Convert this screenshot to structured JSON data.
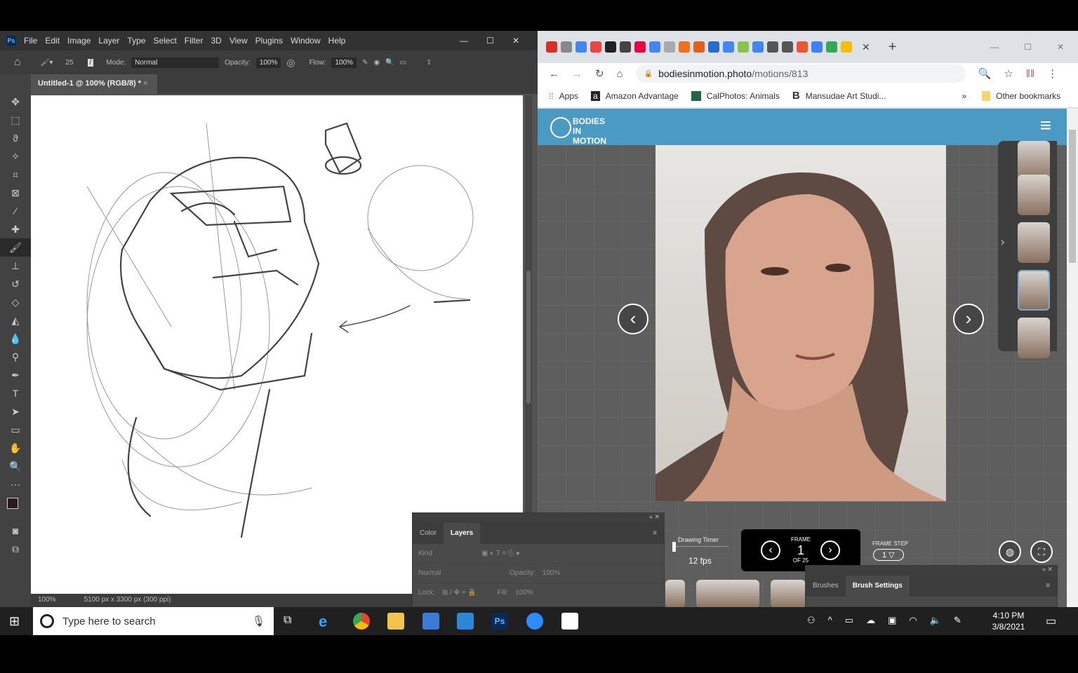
{
  "photoshop": {
    "menu": [
      "File",
      "Edit",
      "Image",
      "Layer",
      "Type",
      "Select",
      "Filter",
      "3D",
      "View",
      "Plugins",
      "Window",
      "Help"
    ],
    "options": {
      "brush_size": "25",
      "mode_label": "Mode:",
      "mode_value": "Normal",
      "opacity_label": "Opacity:",
      "opacity_value": "100%",
      "flow_label": "Flow:",
      "flow_value": "100%"
    },
    "doc_tab": "Untitled-1 @ 100% (RGB/8) *",
    "status": {
      "zoom": "100%",
      "doc_size": "5100 px x 3300 px (300 ppi)"
    },
    "layers_panel": {
      "tabs": [
        "Color",
        "Layers"
      ],
      "kind": "Kind",
      "blend": "Normal",
      "opacity_label": "Opacity:",
      "opacity_value": "100%",
      "lock_label": "Lock:",
      "fill_label": "Fill:",
      "fill_value": "100%"
    },
    "brush_panel": {
      "tabs": [
        "Brushes",
        "Brush Settings"
      ]
    }
  },
  "chrome": {
    "url_domain": "bodiesinmotion.photo",
    "url_path": "/motions/813",
    "bookmarks": [
      "Apps",
      "Amazon Advantage",
      "CalPhotos: Animals",
      "Mansudae Art Studi..."
    ],
    "other_bookmarks": "Other bookmarks",
    "tab_colors": [
      "#d93025",
      "#888",
      "#4285f4",
      "#e44",
      "#222",
      "#444",
      "#e04",
      "#4285f4",
      "#aaa",
      "#f26f21",
      "#e06020",
      "#2a6bd0",
      "#4285f4",
      "#8bc34a",
      "#4285f4",
      "#555",
      "#555",
      "#e53",
      "#3b82f6",
      "#34a853",
      "#fbbc04"
    ]
  },
  "site": {
    "logo": "BODIES IN MOTION",
    "brand_color": "#4a9ac4",
    "drawing_timer_label": "Drawing Timer",
    "fps": "12 fps",
    "frame_label": "FRAME",
    "frame_number": "1",
    "frame_of": "OF 25",
    "frame_step_label": "FRAME STEP",
    "frame_step_value": "1"
  },
  "taskbar": {
    "search_placeholder": "Type here to search",
    "time": "4:10 PM",
    "date": "3/8/2021"
  }
}
